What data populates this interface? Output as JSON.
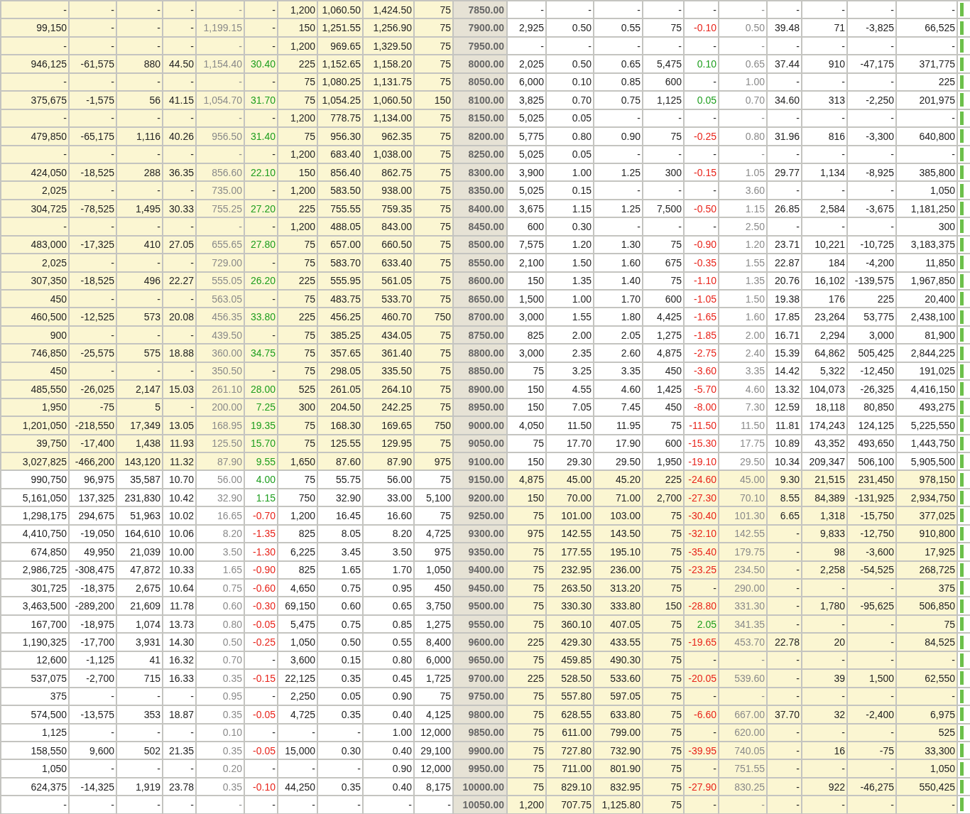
{
  "rows": [
    {
      "strike": "7850.00",
      "call_itm": true,
      "put_itm": false,
      "call_up": false,
      "call_down": false,
      "put_up": false,
      "put_down": false,
      "call": [
        "-",
        "-",
        "-",
        "-",
        "-",
        "-",
        "1,200",
        "1,060.50",
        "1,424.50",
        "75"
      ],
      "put": [
        "-",
        "-",
        "-",
        "-",
        "-",
        "-",
        "-",
        "-",
        "-",
        "-"
      ]
    },
    {
      "strike": "7900.00",
      "call_itm": true,
      "put_itm": false,
      "call_up": false,
      "call_down": false,
      "put_up": false,
      "put_down": true,
      "call": [
        "99,150",
        "-",
        "-",
        "-",
        "1,199.15",
        "-",
        "150",
        "1,251.55",
        "1,256.90",
        "75"
      ],
      "put": [
        "2,925",
        "0.50",
        "0.55",
        "75",
        "-0.10",
        "0.50",
        "39.48",
        "71",
        "-3,825",
        "66,525"
      ]
    },
    {
      "strike": "7950.00",
      "call_itm": true,
      "put_itm": false,
      "call_up": false,
      "call_down": false,
      "put_up": false,
      "put_down": false,
      "call": [
        "-",
        "-",
        "-",
        "-",
        "-",
        "-",
        "1,200",
        "969.65",
        "1,329.50",
        "75"
      ],
      "put": [
        "-",
        "-",
        "-",
        "-",
        "-",
        "-",
        "-",
        "-",
        "-",
        "-"
      ]
    },
    {
      "strike": "8000.00",
      "call_itm": true,
      "put_itm": false,
      "call_up": true,
      "call_down": false,
      "put_up": true,
      "put_down": false,
      "call": [
        "946,125",
        "-61,575",
        "880",
        "44.50",
        "1,154.40",
        "30.40",
        "225",
        "1,152.65",
        "1,158.20",
        "75"
      ],
      "put": [
        "2,025",
        "0.50",
        "0.65",
        "5,475",
        "0.10",
        "0.65",
        "37.44",
        "910",
        "-47,175",
        "371,775"
      ]
    },
    {
      "strike": "8050.00",
      "call_itm": true,
      "put_itm": false,
      "call_up": false,
      "call_down": false,
      "put_up": false,
      "put_down": false,
      "call": [
        "-",
        "-",
        "-",
        "-",
        "-",
        "-",
        "75",
        "1,080.25",
        "1,131.75",
        "75"
      ],
      "put": [
        "6,000",
        "0.10",
        "0.85",
        "600",
        "-",
        "1.00",
        "-",
        "-",
        "-",
        "225"
      ]
    },
    {
      "strike": "8100.00",
      "call_itm": true,
      "put_itm": false,
      "call_up": true,
      "call_down": false,
      "put_up": true,
      "put_down": false,
      "call": [
        "375,675",
        "-1,575",
        "56",
        "41.15",
        "1,054.70",
        "31.70",
        "75",
        "1,054.25",
        "1,060.50",
        "150"
      ],
      "put": [
        "3,825",
        "0.70",
        "0.75",
        "1,125",
        "0.05",
        "0.70",
        "34.60",
        "313",
        "-2,250",
        "201,975"
      ]
    },
    {
      "strike": "8150.00",
      "call_itm": true,
      "put_itm": false,
      "call_up": false,
      "call_down": false,
      "put_up": false,
      "put_down": false,
      "call": [
        "-",
        "-",
        "-",
        "-",
        "-",
        "-",
        "1,200",
        "778.75",
        "1,134.00",
        "75"
      ],
      "put": [
        "5,025",
        "0.05",
        "-",
        "-",
        "-",
        "-",
        "-",
        "-",
        "-",
        "-"
      ]
    },
    {
      "strike": "8200.00",
      "call_itm": true,
      "put_itm": false,
      "call_up": true,
      "call_down": false,
      "put_up": false,
      "put_down": true,
      "call": [
        "479,850",
        "-65,175",
        "1,116",
        "40.26",
        "956.50",
        "31.40",
        "75",
        "956.30",
        "962.35",
        "75"
      ],
      "put": [
        "5,775",
        "0.80",
        "0.90",
        "75",
        "-0.25",
        "0.80",
        "31.96",
        "816",
        "-3,300",
        "640,800"
      ]
    },
    {
      "strike": "8250.00",
      "call_itm": true,
      "put_itm": false,
      "call_up": false,
      "call_down": false,
      "put_up": false,
      "put_down": false,
      "call": [
        "-",
        "-",
        "-",
        "-",
        "-",
        "-",
        "1,200",
        "683.40",
        "1,038.00",
        "75"
      ],
      "put": [
        "5,025",
        "0.05",
        "-",
        "-",
        "-",
        "-",
        "-",
        "-",
        "-",
        "-"
      ]
    },
    {
      "strike": "8300.00",
      "call_itm": true,
      "put_itm": false,
      "call_up": true,
      "call_down": false,
      "put_up": false,
      "put_down": true,
      "call": [
        "424,050",
        "-18,525",
        "288",
        "36.35",
        "856.60",
        "22.10",
        "150",
        "856.40",
        "862.75",
        "75"
      ],
      "put": [
        "3,900",
        "1.00",
        "1.25",
        "300",
        "-0.15",
        "1.05",
        "29.77",
        "1,134",
        "-8,925",
        "385,800"
      ]
    },
    {
      "strike": "8350.00",
      "call_itm": true,
      "put_itm": false,
      "call_up": false,
      "call_down": false,
      "put_up": false,
      "put_down": false,
      "call": [
        "2,025",
        "-",
        "-",
        "-",
        "735.00",
        "-",
        "1,200",
        "583.50",
        "938.00",
        "75"
      ],
      "put": [
        "5,025",
        "0.15",
        "-",
        "-",
        "-",
        "3.60",
        "-",
        "-",
        "-",
        "1,050"
      ]
    },
    {
      "strike": "8400.00",
      "call_itm": true,
      "put_itm": false,
      "call_up": true,
      "call_down": false,
      "put_up": false,
      "put_down": true,
      "call": [
        "304,725",
        "-78,525",
        "1,495",
        "30.33",
        "755.25",
        "27.20",
        "225",
        "755.55",
        "759.35",
        "75"
      ],
      "put": [
        "3,675",
        "1.15",
        "1.25",
        "7,500",
        "-0.50",
        "1.15",
        "26.85",
        "2,584",
        "-3,675",
        "1,181,250"
      ]
    },
    {
      "strike": "8450.00",
      "call_itm": true,
      "put_itm": false,
      "call_up": false,
      "call_down": false,
      "put_up": false,
      "put_down": false,
      "call": [
        "-",
        "-",
        "-",
        "-",
        "-",
        "-",
        "1,200",
        "488.05",
        "843.00",
        "75"
      ],
      "put": [
        "600",
        "0.30",
        "-",
        "-",
        "-",
        "2.50",
        "-",
        "-",
        "-",
        "300"
      ]
    },
    {
      "strike": "8500.00",
      "call_itm": true,
      "put_itm": false,
      "call_up": true,
      "call_down": false,
      "put_up": false,
      "put_down": true,
      "call": [
        "483,000",
        "-17,325",
        "410",
        "27.05",
        "655.65",
        "27.80",
        "75",
        "657.00",
        "660.50",
        "75"
      ],
      "put": [
        "7,575",
        "1.20",
        "1.30",
        "75",
        "-0.90",
        "1.20",
        "23.71",
        "10,221",
        "-10,725",
        "3,183,375"
      ]
    },
    {
      "strike": "8550.00",
      "call_itm": true,
      "put_itm": false,
      "call_up": false,
      "call_down": false,
      "put_up": false,
      "put_down": true,
      "call": [
        "2,025",
        "-",
        "-",
        "-",
        "729.00",
        "-",
        "75",
        "583.70",
        "633.40",
        "75"
      ],
      "put": [
        "2,100",
        "1.50",
        "1.60",
        "675",
        "-0.35",
        "1.55",
        "22.87",
        "184",
        "-4,200",
        "11,850"
      ]
    },
    {
      "strike": "8600.00",
      "call_itm": true,
      "put_itm": false,
      "call_up": true,
      "call_down": false,
      "put_up": false,
      "put_down": true,
      "call": [
        "307,350",
        "-18,525",
        "496",
        "22.27",
        "555.05",
        "26.20",
        "225",
        "555.95",
        "561.05",
        "75"
      ],
      "put": [
        "150",
        "1.35",
        "1.40",
        "75",
        "-1.10",
        "1.35",
        "20.76",
        "16,102",
        "-139,575",
        "1,967,850"
      ]
    },
    {
      "strike": "8650.00",
      "call_itm": true,
      "put_itm": false,
      "call_up": false,
      "call_down": false,
      "put_up": false,
      "put_down": true,
      "call": [
        "450",
        "-",
        "-",
        "-",
        "563.05",
        "-",
        "75",
        "483.75",
        "533.70",
        "75"
      ],
      "put": [
        "1,500",
        "1.00",
        "1.70",
        "600",
        "-1.05",
        "1.50",
        "19.38",
        "176",
        "225",
        "20,400"
      ]
    },
    {
      "strike": "8700.00",
      "call_itm": true,
      "put_itm": false,
      "call_up": true,
      "call_down": false,
      "put_up": false,
      "put_down": true,
      "call": [
        "460,500",
        "-12,525",
        "573",
        "20.08",
        "456.35",
        "33.80",
        "225",
        "456.25",
        "460.70",
        "750"
      ],
      "put": [
        "3,000",
        "1.55",
        "1.80",
        "4,425",
        "-1.65",
        "1.60",
        "17.85",
        "23,264",
        "53,775",
        "2,438,100"
      ]
    },
    {
      "strike": "8750.00",
      "call_itm": true,
      "put_itm": false,
      "call_up": false,
      "call_down": false,
      "put_up": false,
      "put_down": true,
      "call": [
        "900",
        "-",
        "-",
        "-",
        "439.50",
        "-",
        "75",
        "385.25",
        "434.05",
        "75"
      ],
      "put": [
        "825",
        "2.00",
        "2.05",
        "1,275",
        "-1.85",
        "2.00",
        "16.71",
        "2,294",
        "3,000",
        "81,900"
      ]
    },
    {
      "strike": "8800.00",
      "call_itm": true,
      "put_itm": false,
      "call_up": true,
      "call_down": false,
      "put_up": false,
      "put_down": true,
      "call": [
        "746,850",
        "-25,575",
        "575",
        "18.88",
        "360.00",
        "34.75",
        "75",
        "357.65",
        "361.40",
        "75"
      ],
      "put": [
        "3,000",
        "2.35",
        "2.60",
        "4,875",
        "-2.75",
        "2.40",
        "15.39",
        "64,862",
        "505,425",
        "2,844,225"
      ]
    },
    {
      "strike": "8850.00",
      "call_itm": true,
      "put_itm": false,
      "call_up": false,
      "call_down": false,
      "put_up": false,
      "put_down": true,
      "call": [
        "450",
        "-",
        "-",
        "-",
        "350.50",
        "-",
        "75",
        "298.05",
        "335.50",
        "75"
      ],
      "put": [
        "75",
        "3.25",
        "3.35",
        "450",
        "-3.60",
        "3.35",
        "14.42",
        "5,322",
        "-12,450",
        "191,025"
      ]
    },
    {
      "strike": "8900.00",
      "call_itm": true,
      "put_itm": false,
      "call_up": true,
      "call_down": false,
      "put_up": false,
      "put_down": true,
      "call": [
        "485,550",
        "-26,025",
        "2,147",
        "15.03",
        "261.10",
        "28.00",
        "525",
        "261.05",
        "264.10",
        "75"
      ],
      "put": [
        "150",
        "4.55",
        "4.60",
        "1,425",
        "-5.70",
        "4.60",
        "13.32",
        "104,073",
        "-26,325",
        "4,416,150"
      ]
    },
    {
      "strike": "8950.00",
      "call_itm": true,
      "put_itm": false,
      "call_up": true,
      "call_down": false,
      "put_up": false,
      "put_down": true,
      "call": [
        "1,950",
        "-75",
        "5",
        "-",
        "200.00",
        "7.25",
        "300",
        "204.50",
        "242.25",
        "75"
      ],
      "put": [
        "150",
        "7.05",
        "7.45",
        "450",
        "-8.00",
        "7.30",
        "12.59",
        "18,118",
        "80,850",
        "493,275"
      ]
    },
    {
      "strike": "9000.00",
      "call_itm": true,
      "put_itm": false,
      "call_up": true,
      "call_down": false,
      "put_up": false,
      "put_down": true,
      "call": [
        "1,201,050",
        "-218,550",
        "17,349",
        "13.05",
        "168.95",
        "19.35",
        "75",
        "168.30",
        "169.65",
        "750"
      ],
      "put": [
        "4,050",
        "11.50",
        "11.95",
        "75",
        "-11.50",
        "11.50",
        "11.81",
        "174,243",
        "124,125",
        "5,225,550"
      ]
    },
    {
      "strike": "9050.00",
      "call_itm": true,
      "put_itm": false,
      "call_up": true,
      "call_down": false,
      "put_up": false,
      "put_down": true,
      "call": [
        "39,750",
        "-17,400",
        "1,438",
        "11.93",
        "125.50",
        "15.70",
        "75",
        "125.55",
        "129.95",
        "75"
      ],
      "put": [
        "75",
        "17.70",
        "17.90",
        "600",
        "-15.30",
        "17.75",
        "10.89",
        "43,352",
        "493,650",
        "1,443,750"
      ]
    },
    {
      "strike": "9100.00",
      "call_itm": true,
      "put_itm": false,
      "call_up": true,
      "call_down": false,
      "put_up": false,
      "put_down": true,
      "call": [
        "3,027,825",
        "-466,200",
        "143,120",
        "11.32",
        "87.90",
        "9.55",
        "1,650",
        "87.60",
        "87.90",
        "975"
      ],
      "put": [
        "150",
        "29.30",
        "29.50",
        "1,950",
        "-19.10",
        "29.50",
        "10.34",
        "209,347",
        "506,100",
        "5,905,500"
      ]
    },
    {
      "strike": "9150.00",
      "call_itm": false,
      "put_itm": true,
      "call_up": true,
      "call_down": false,
      "put_up": false,
      "put_down": true,
      "call": [
        "990,750",
        "96,975",
        "35,587",
        "10.70",
        "56.00",
        "4.00",
        "75",
        "55.75",
        "56.00",
        "75"
      ],
      "put": [
        "4,875",
        "45.00",
        "45.20",
        "225",
        "-24.60",
        "45.00",
        "9.30",
        "21,515",
        "231,450",
        "978,150"
      ]
    },
    {
      "strike": "9200.00",
      "call_itm": false,
      "put_itm": true,
      "call_up": true,
      "call_down": false,
      "put_up": false,
      "put_down": true,
      "call": [
        "5,161,050",
        "137,325",
        "231,830",
        "10.42",
        "32.90",
        "1.15",
        "750",
        "32.90",
        "33.00",
        "5,100"
      ],
      "put": [
        "150",
        "70.00",
        "71.00",
        "2,700",
        "-27.30",
        "70.10",
        "8.55",
        "84,389",
        "-131,925",
        "2,934,750"
      ]
    },
    {
      "strike": "9250.00",
      "call_itm": false,
      "put_itm": true,
      "call_up": false,
      "call_down": true,
      "put_up": false,
      "put_down": true,
      "call": [
        "1,298,175",
        "294,675",
        "51,963",
        "10.02",
        "16.65",
        "-0.70",
        "1,200",
        "16.45",
        "16.60",
        "75"
      ],
      "put": [
        "75",
        "101.00",
        "103.00",
        "75",
        "-30.40",
        "101.30",
        "6.65",
        "1,318",
        "-15,750",
        "377,025"
      ]
    },
    {
      "strike": "9300.00",
      "call_itm": false,
      "put_itm": true,
      "call_up": false,
      "call_down": true,
      "put_up": false,
      "put_down": true,
      "call": [
        "4,410,750",
        "-19,050",
        "164,610",
        "10.06",
        "8.20",
        "-1.35",
        "825",
        "8.05",
        "8.20",
        "4,725"
      ],
      "put": [
        "975",
        "142.55",
        "143.50",
        "75",
        "-32.10",
        "142.55",
        "-",
        "9,833",
        "-12,750",
        "910,800"
      ]
    },
    {
      "strike": "9350.00",
      "call_itm": false,
      "put_itm": true,
      "call_up": false,
      "call_down": true,
      "put_up": false,
      "put_down": true,
      "call": [
        "674,850",
        "49,950",
        "21,039",
        "10.00",
        "3.50",
        "-1.30",
        "6,225",
        "3.45",
        "3.50",
        "975"
      ],
      "put": [
        "75",
        "177.55",
        "195.10",
        "75",
        "-35.40",
        "179.75",
        "-",
        "98",
        "-3,600",
        "17,925"
      ]
    },
    {
      "strike": "9400.00",
      "call_itm": false,
      "put_itm": true,
      "call_up": false,
      "call_down": true,
      "put_up": false,
      "put_down": true,
      "call": [
        "2,986,725",
        "-308,475",
        "47,872",
        "10.33",
        "1.65",
        "-0.90",
        "825",
        "1.65",
        "1.70",
        "1,050"
      ],
      "put": [
        "75",
        "232.95",
        "236.00",
        "75",
        "-23.25",
        "234.50",
        "-",
        "2,258",
        "-54,525",
        "268,725"
      ]
    },
    {
      "strike": "9450.00",
      "call_itm": false,
      "put_itm": true,
      "call_up": false,
      "call_down": true,
      "put_up": false,
      "put_down": false,
      "call": [
        "301,725",
        "-18,375",
        "2,675",
        "10.64",
        "0.75",
        "-0.60",
        "4,650",
        "0.75",
        "0.95",
        "450"
      ],
      "put": [
        "75",
        "263.50",
        "313.20",
        "75",
        "-",
        "290.00",
        "-",
        "-",
        "-",
        "375"
      ]
    },
    {
      "strike": "9500.00",
      "call_itm": false,
      "put_itm": true,
      "call_up": false,
      "call_down": true,
      "put_up": false,
      "put_down": true,
      "call": [
        "3,463,500",
        "-289,200",
        "21,609",
        "11.78",
        "0.60",
        "-0.30",
        "69,150",
        "0.60",
        "0.65",
        "3,750"
      ],
      "put": [
        "75",
        "330.30",
        "333.80",
        "150",
        "-28.80",
        "331.30",
        "-",
        "1,780",
        "-95,625",
        "506,850"
      ]
    },
    {
      "strike": "9550.00",
      "call_itm": false,
      "put_itm": true,
      "call_up": false,
      "call_down": true,
      "put_up": true,
      "put_down": false,
      "call": [
        "167,700",
        "-18,975",
        "1,074",
        "13.73",
        "0.80",
        "-0.05",
        "5,475",
        "0.75",
        "0.85",
        "1,275"
      ],
      "put": [
        "75",
        "360.10",
        "407.05",
        "75",
        "2.05",
        "341.35",
        "-",
        "-",
        "-",
        "75"
      ]
    },
    {
      "strike": "9600.00",
      "call_itm": false,
      "put_itm": true,
      "call_up": false,
      "call_down": true,
      "put_up": false,
      "put_down": true,
      "call": [
        "1,190,325",
        "-17,700",
        "3,931",
        "14.30",
        "0.50",
        "-0.25",
        "1,050",
        "0.50",
        "0.55",
        "8,400"
      ],
      "put": [
        "225",
        "429.30",
        "433.55",
        "75",
        "-19.65",
        "453.70",
        "22.78",
        "20",
        "-",
        "84,525"
      ]
    },
    {
      "strike": "9650.00",
      "call_itm": false,
      "put_itm": true,
      "call_up": false,
      "call_down": false,
      "put_up": false,
      "put_down": false,
      "call": [
        "12,600",
        "-1,125",
        "41",
        "16.32",
        "0.70",
        "-",
        "3,600",
        "0.15",
        "0.80",
        "6,000"
      ],
      "put": [
        "75",
        "459.85",
        "490.30",
        "75",
        "-",
        "-",
        "-",
        "-",
        "-",
        "-"
      ]
    },
    {
      "strike": "9700.00",
      "call_itm": false,
      "put_itm": true,
      "call_up": false,
      "call_down": true,
      "put_up": false,
      "put_down": true,
      "call": [
        "537,075",
        "-2,700",
        "715",
        "16.33",
        "0.35",
        "-0.15",
        "22,125",
        "0.35",
        "0.45",
        "1,725"
      ],
      "put": [
        "225",
        "528.50",
        "533.60",
        "75",
        "-20.05",
        "539.60",
        "-",
        "39",
        "1,500",
        "62,550"
      ]
    },
    {
      "strike": "9750.00",
      "call_itm": false,
      "put_itm": true,
      "call_up": false,
      "call_down": false,
      "put_up": false,
      "put_down": false,
      "call": [
        "375",
        "-",
        "-",
        "-",
        "0.95",
        "-",
        "2,250",
        "0.05",
        "0.90",
        "75"
      ],
      "put": [
        "75",
        "557.80",
        "597.05",
        "75",
        "-",
        "-",
        "-",
        "-",
        "-",
        "-"
      ]
    },
    {
      "strike": "9800.00",
      "call_itm": false,
      "put_itm": true,
      "call_up": false,
      "call_down": true,
      "put_up": false,
      "put_down": true,
      "call": [
        "574,500",
        "-13,575",
        "353",
        "18.87",
        "0.35",
        "-0.05",
        "4,725",
        "0.35",
        "0.40",
        "4,125"
      ],
      "put": [
        "75",
        "628.55",
        "633.80",
        "75",
        "-6.60",
        "667.00",
        "37.70",
        "32",
        "-2,400",
        "6,975"
      ]
    },
    {
      "strike": "9850.00",
      "call_itm": false,
      "put_itm": true,
      "call_up": false,
      "call_down": false,
      "put_up": false,
      "put_down": false,
      "call": [
        "1,125",
        "-",
        "-",
        "-",
        "0.10",
        "-",
        "-",
        "-",
        "1.00",
        "12,000"
      ],
      "put": [
        "75",
        "611.00",
        "799.00",
        "75",
        "-",
        "620.00",
        "-",
        "-",
        "-",
        "525"
      ]
    },
    {
      "strike": "9900.00",
      "call_itm": false,
      "put_itm": true,
      "call_up": false,
      "call_down": true,
      "put_up": false,
      "put_down": true,
      "call": [
        "158,550",
        "9,600",
        "502",
        "21.35",
        "0.35",
        "-0.05",
        "15,000",
        "0.30",
        "0.40",
        "29,100"
      ],
      "put": [
        "75",
        "727.80",
        "732.90",
        "75",
        "-39.95",
        "740.05",
        "-",
        "16",
        "-75",
        "33,300"
      ]
    },
    {
      "strike": "9950.00",
      "call_itm": false,
      "put_itm": true,
      "call_up": false,
      "call_down": false,
      "put_up": false,
      "put_down": false,
      "call": [
        "1,050",
        "-",
        "-",
        "-",
        "0.20",
        "-",
        "-",
        "-",
        "0.90",
        "12,000"
      ],
      "put": [
        "75",
        "711.00",
        "801.90",
        "75",
        "-",
        "751.55",
        "-",
        "-",
        "-",
        "1,050"
      ]
    },
    {
      "strike": "10000.00",
      "call_itm": false,
      "put_itm": true,
      "call_up": false,
      "call_down": true,
      "put_up": false,
      "put_down": true,
      "call": [
        "624,375",
        "-14,325",
        "1,919",
        "23.78",
        "0.35",
        "-0.10",
        "44,250",
        "0.35",
        "0.40",
        "8,175"
      ],
      "put": [
        "75",
        "829.10",
        "832.95",
        "75",
        "-27.90",
        "830.25",
        "-",
        "922",
        "-46,275",
        "550,425"
      ]
    },
    {
      "strike": "10050.00",
      "call_itm": false,
      "put_itm": true,
      "call_up": false,
      "call_down": false,
      "put_up": false,
      "put_down": false,
      "call": [
        "-",
        "-",
        "-",
        "-",
        "-",
        "-",
        "-",
        "-",
        "-",
        "-"
      ],
      "put": [
        "1,200",
        "707.75",
        "1,125.80",
        "75",
        "-",
        "-",
        "-",
        "-",
        "-",
        "-"
      ]
    }
  ]
}
